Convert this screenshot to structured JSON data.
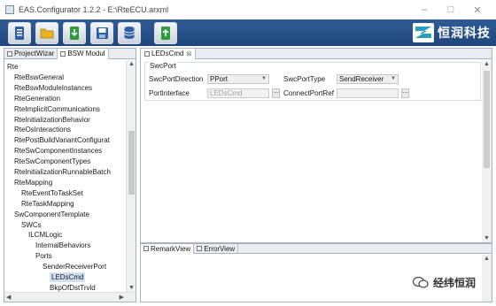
{
  "window": {
    "title": "EAS.Configurator 1.2.2 - E:\\RteECU.arxml",
    "controls": [
      "–",
      "□",
      "✕"
    ]
  },
  "toolbar": {
    "buttons": [
      "new-icon",
      "open-icon",
      "import-icon",
      "save-icon",
      "database-icon",
      "export-icon"
    ],
    "logo_text": "恒润科技"
  },
  "left_panel": {
    "tabs": [
      "ProjectWizar",
      "BSW Modul"
    ],
    "tree": [
      {
        "label": "Rte",
        "level": 0
      },
      {
        "label": "RteBswGeneral",
        "level": 1
      },
      {
        "label": "RteBswModuleInstances",
        "level": 1
      },
      {
        "label": "RteGeneration",
        "level": 1
      },
      {
        "label": "RteImplicitCommunications",
        "level": 1
      },
      {
        "label": "RteInitializationBehavior",
        "level": 1
      },
      {
        "label": "RteOsInteractions",
        "level": 1
      },
      {
        "label": "RtePostBuildVariantConfigurat",
        "level": 1
      },
      {
        "label": "RteSwComponentInstances",
        "level": 1
      },
      {
        "label": "RteSwComponentTypes",
        "level": 1
      },
      {
        "label": "RteInitializationRunnableBatch",
        "level": 1
      },
      {
        "label": "RteMapping",
        "level": 1
      },
      {
        "label": "RteEventToTaskSet",
        "level": 2
      },
      {
        "label": "RteTaskMapping",
        "level": 2
      },
      {
        "label": "SwComponentTemplate",
        "level": 1
      },
      {
        "label": "SWCs",
        "level": 2
      },
      {
        "label": "ILCMLogic",
        "level": 3
      },
      {
        "label": "InternalBehaviors",
        "level": 4
      },
      {
        "label": "Ports",
        "level": 4
      },
      {
        "label": "SenderReceiverPort",
        "level": 5
      },
      {
        "label": "LEDsCmd",
        "level": 6,
        "selected": true
      },
      {
        "label": "BkpOfDstTrvld",
        "level": 6
      }
    ]
  },
  "editor": {
    "tab_label": "LEDsCmd",
    "tab_close": "⊠",
    "group_title": "SwcPort",
    "fields": {
      "direction_label": "SwcPortDirection",
      "direction_value": "PPort",
      "type_label": "SwcPortType",
      "type_value": "SendReceiver",
      "interface_label": "PortInterface",
      "interface_value": "LEDsCmd",
      "connect_label": "ConnectPortRef",
      "connect_value": "",
      "browse": "..."
    }
  },
  "bottom_panel": {
    "tabs": [
      "RemarkView",
      "ErrorView"
    ]
  },
  "watermark": {
    "text": "经纬恒润"
  }
}
